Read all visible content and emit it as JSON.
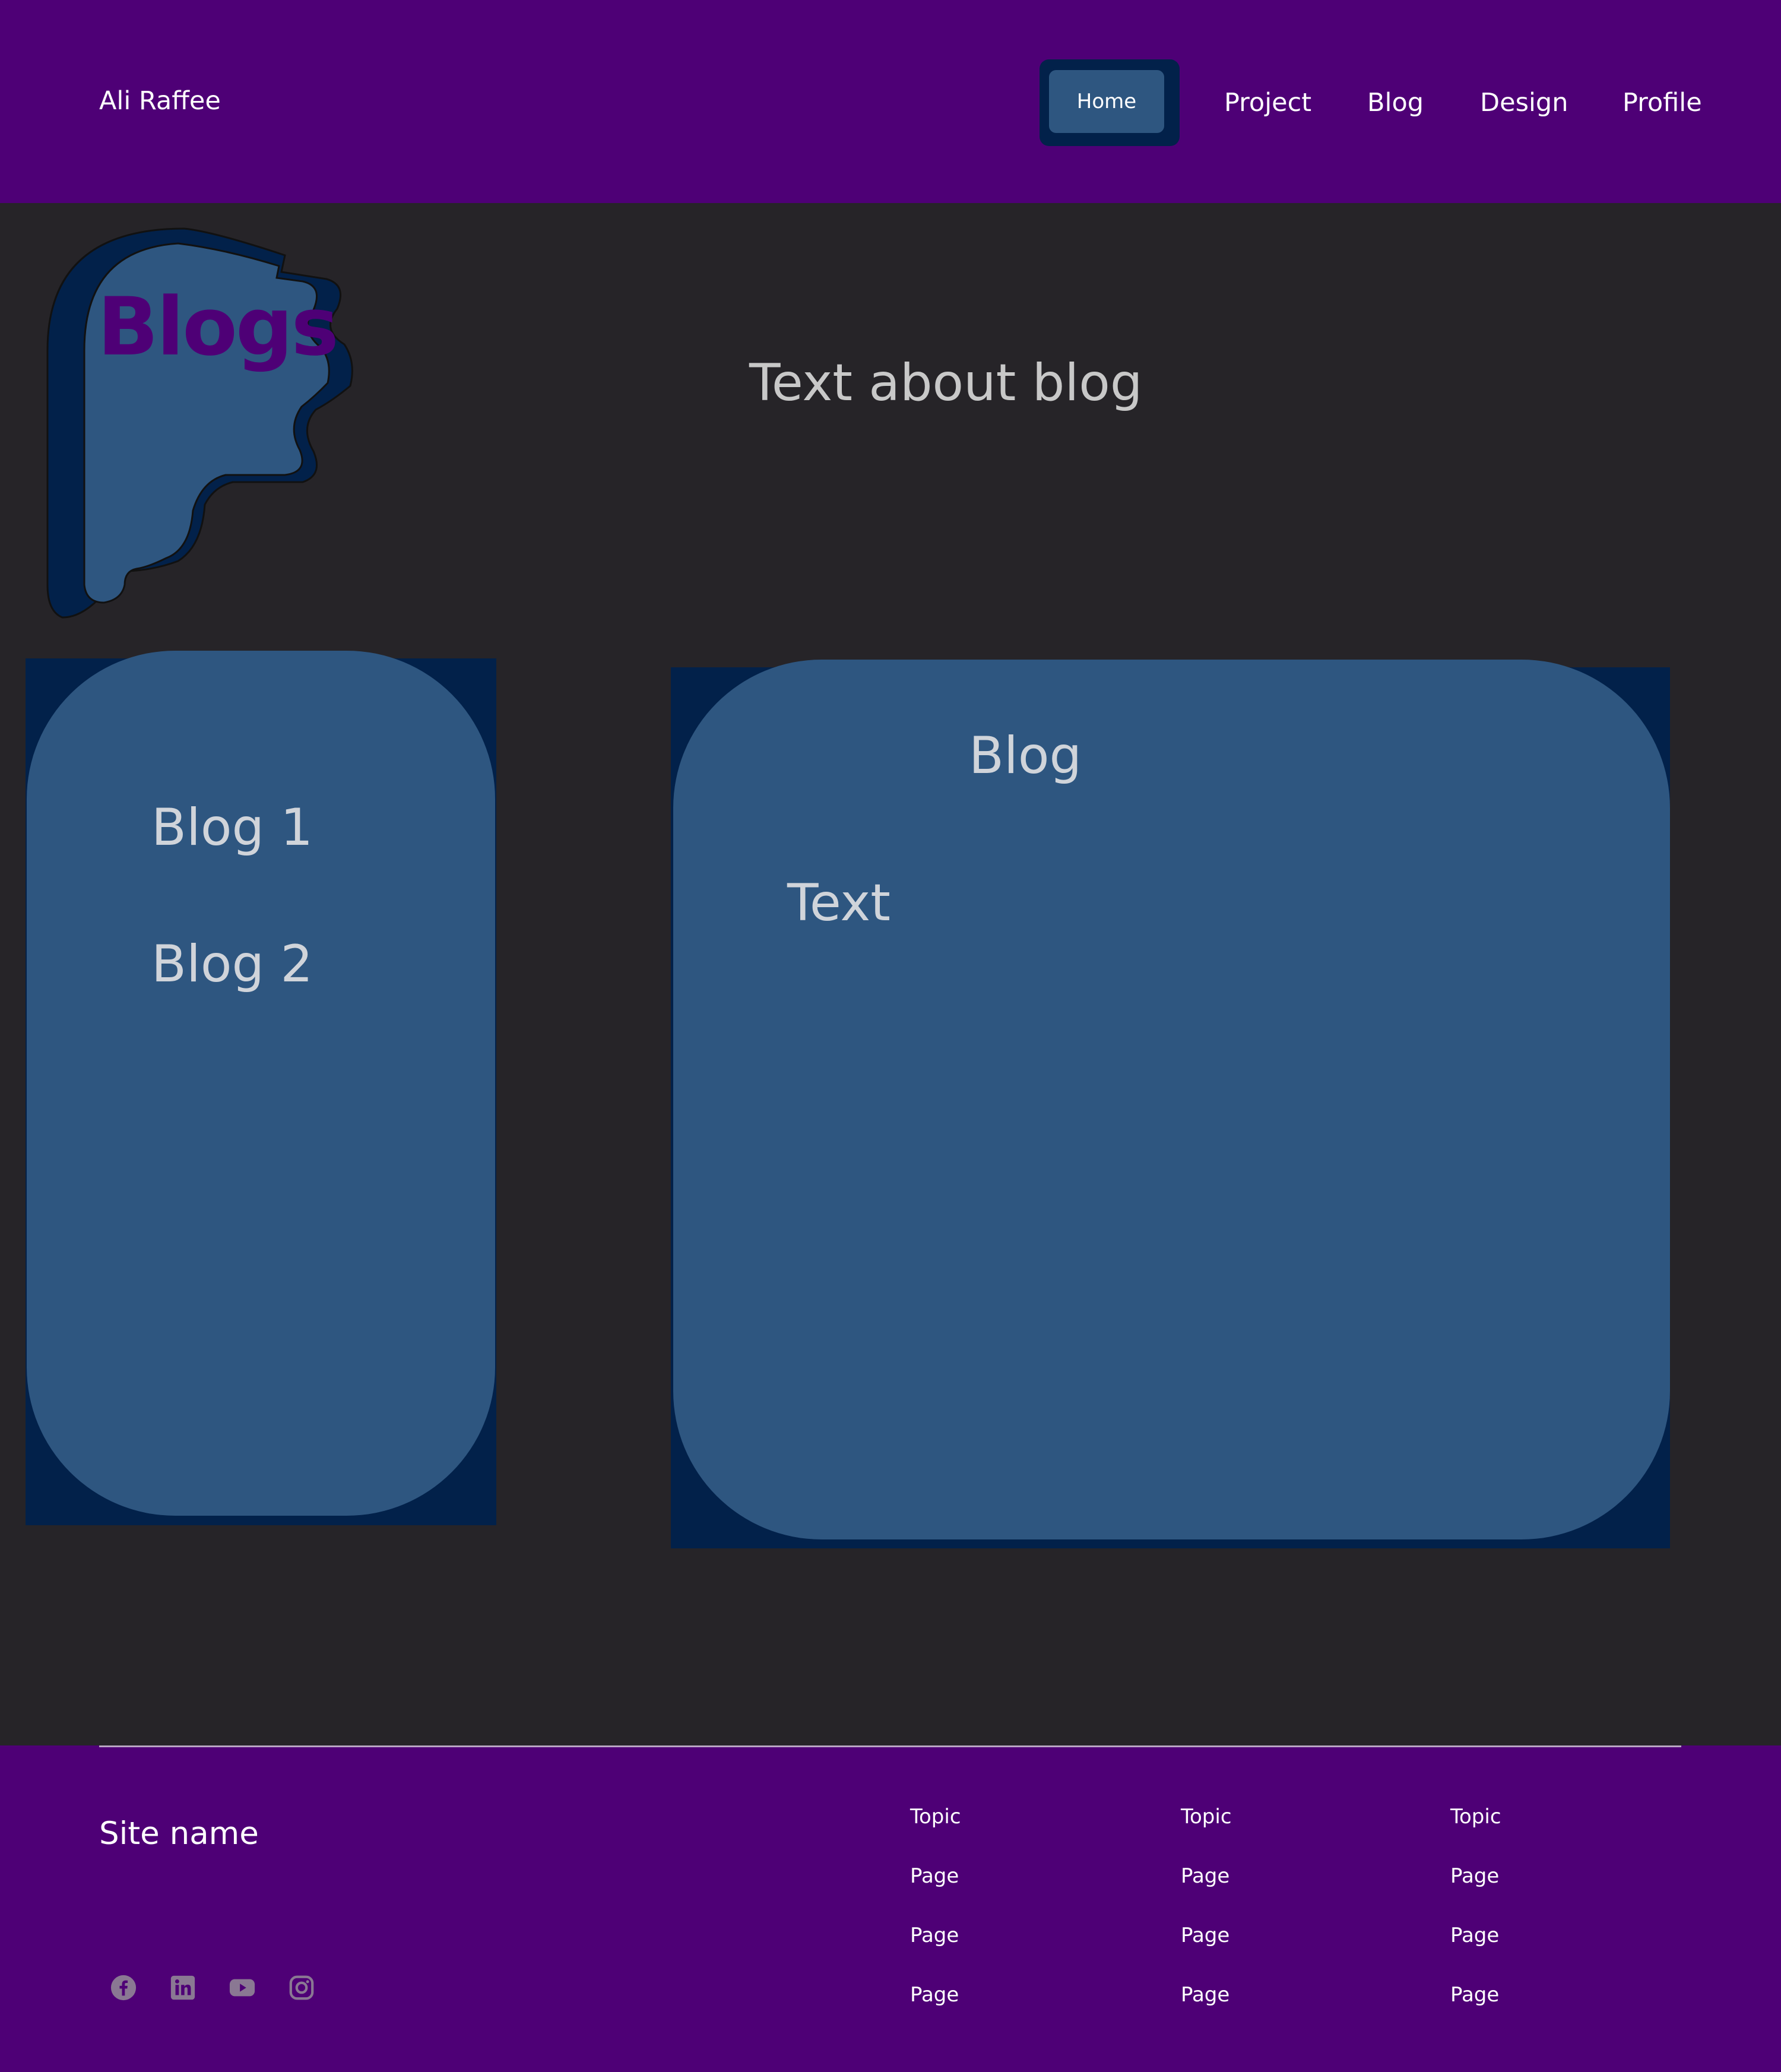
{
  "header": {
    "site_title": "Ali Raffee",
    "nav": {
      "home": "Home",
      "project": "Project",
      "blog": "Blog",
      "design": "Design",
      "profile": "Profile"
    }
  },
  "hero": {
    "title": "Blogs",
    "text": "Text about blog"
  },
  "sidebar": {
    "items": [
      "Blog 1",
      "Blog 2"
    ]
  },
  "main": {
    "title": "Blog",
    "text": "Text"
  },
  "footer": {
    "site_name": "Site name",
    "columns": [
      {
        "topic": "Topic",
        "pages": [
          "Page",
          "Page",
          "Page"
        ]
      },
      {
        "topic": "Topic",
        "pages": [
          "Page",
          "Page",
          "Page"
        ]
      },
      {
        "topic": "Topic",
        "pages": [
          "Page",
          "Page",
          "Page"
        ]
      }
    ],
    "social_icons": [
      "facebook-icon",
      "linkedin-icon",
      "youtube-icon",
      "instagram-icon"
    ]
  },
  "colors": {
    "header_bg": "#4e0076",
    "page_bg": "#262428",
    "panel": "#2e5680",
    "panel_dark": "#02214a"
  }
}
